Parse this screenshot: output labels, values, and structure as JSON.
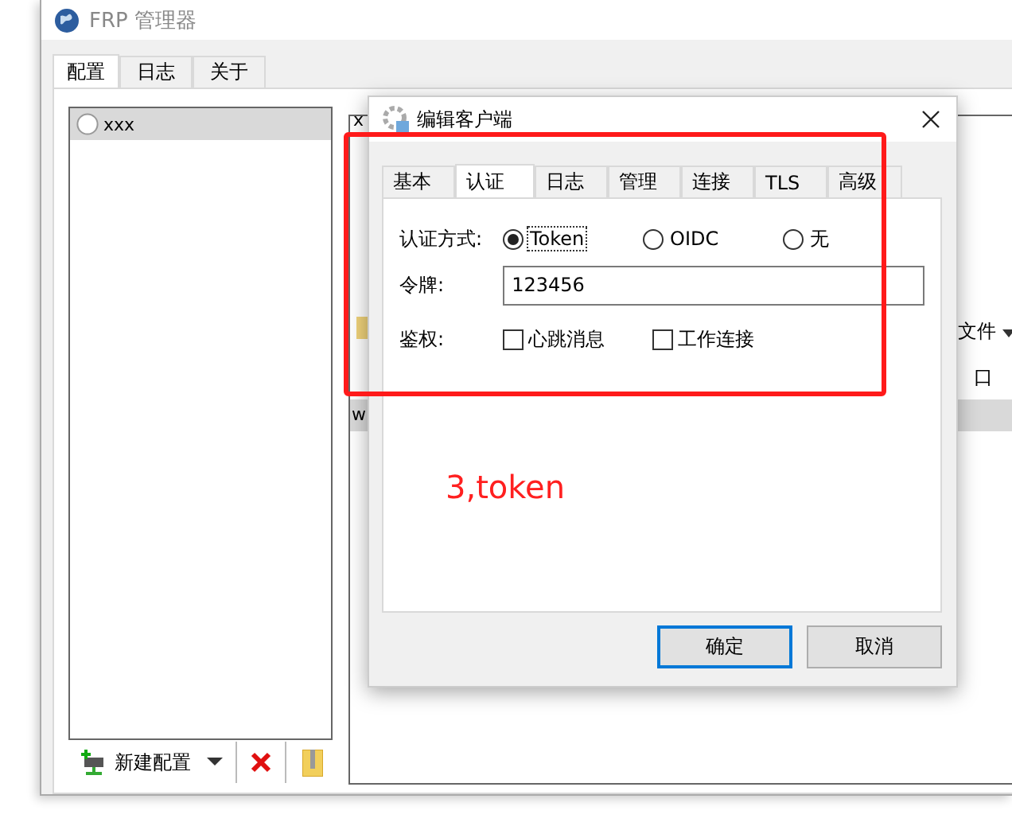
{
  "window": {
    "title": "FRP 管理器"
  },
  "main_tabs": [
    {
      "label": "配置",
      "selected": true
    },
    {
      "label": "日志",
      "selected": false
    },
    {
      "label": "关于",
      "selected": false
    }
  ],
  "config_list": [
    {
      "name": "xxx",
      "selected": true
    }
  ],
  "toolbar": {
    "new_button": "新建配置"
  },
  "background_panel": {
    "title_fragment": "x",
    "row_fragment": "w",
    "files_button": "文件",
    "header_fragment": "口"
  },
  "dialog": {
    "title": "编辑客户端",
    "tabs": [
      {
        "label": "基本",
        "selected": false
      },
      {
        "label": "认证",
        "selected": true
      },
      {
        "label": "日志",
        "selected": false
      },
      {
        "label": "管理",
        "selected": false
      },
      {
        "label": "连接",
        "selected": false
      },
      {
        "label": "TLS",
        "selected": false
      },
      {
        "label": "高级",
        "selected": false
      }
    ],
    "method_label": "认证方式:",
    "methods": [
      {
        "label": "Token",
        "selected": true
      },
      {
        "label": "OIDC",
        "selected": false
      },
      {
        "label": "无",
        "selected": false
      }
    ],
    "token_label": "令牌:",
    "token_value": "123456",
    "scope_label": "鉴权:",
    "scopes": [
      {
        "label": "心跳消息",
        "checked": false
      },
      {
        "label": "工作连接",
        "checked": false
      }
    ],
    "buttons": [
      {
        "label": "确定",
        "default": true
      },
      {
        "label": "取消",
        "default": false
      }
    ]
  },
  "annotation": {
    "text": "3,token"
  }
}
